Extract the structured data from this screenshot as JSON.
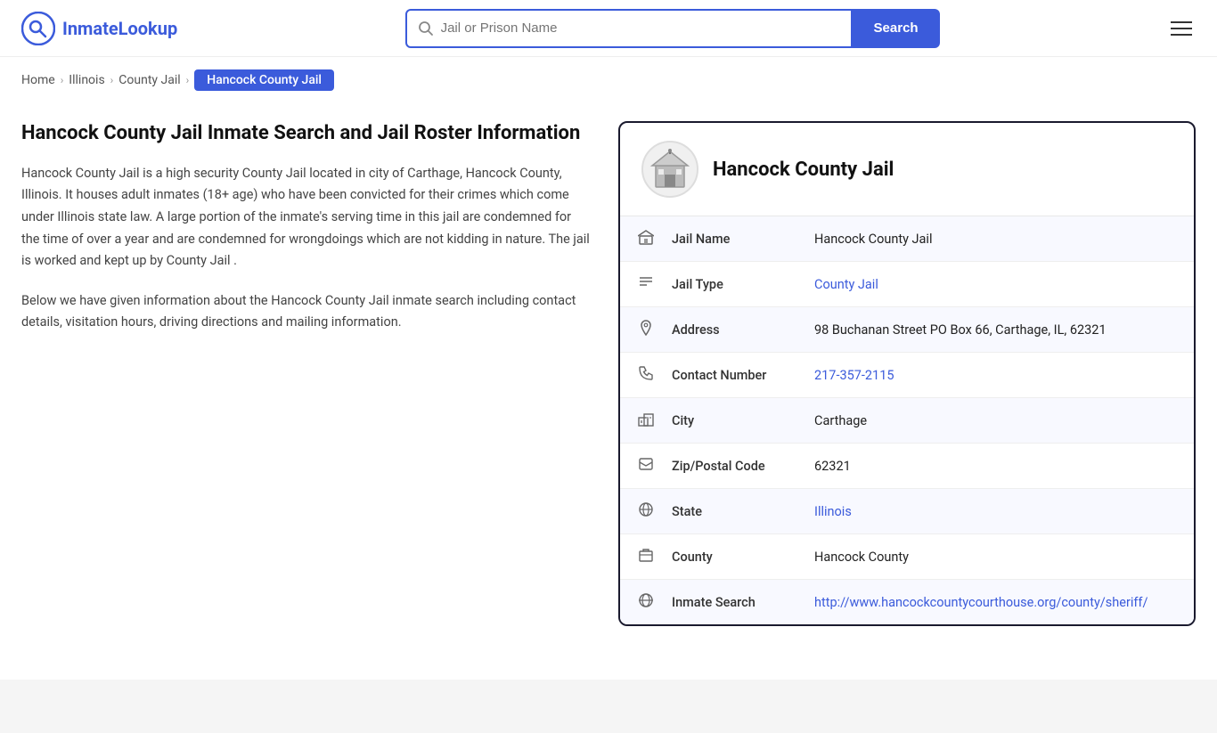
{
  "header": {
    "logo_text_part1": "Inmate",
    "logo_text_part2": "Lookup",
    "search_placeholder": "Jail or Prison Name",
    "search_button_label": "Search"
  },
  "breadcrumb": {
    "home": "Home",
    "illinois": "Illinois",
    "county_jail": "County Jail",
    "current": "Hancock County Jail"
  },
  "left": {
    "title": "Hancock County Jail Inmate Search and Jail Roster Information",
    "desc1": "Hancock County Jail is a high security County Jail located in city of Carthage, Hancock County, Illinois. It houses adult inmates (18+ age) who have been convicted for their crimes which come under Illinois state law. A large portion of the inmate's serving time in this jail are condemned for the time of over a year and are condemned for wrongdoings which are not kidding in nature. The jail is worked and kept up by County Jail .",
    "desc2": "Below we have given information about the Hancock County Jail inmate search including contact details, visitation hours, driving directions and mailing information."
  },
  "card": {
    "jail_name_display": "Hancock County Jail",
    "rows": [
      {
        "icon": "jail",
        "label": "Jail Name",
        "value": "Hancock County Jail",
        "link": null
      },
      {
        "icon": "type",
        "label": "Jail Type",
        "value": "County Jail",
        "link": "#"
      },
      {
        "icon": "address",
        "label": "Address",
        "value": "98 Buchanan Street PO Box 66, Carthage, IL, 62321",
        "link": null
      },
      {
        "icon": "phone",
        "label": "Contact Number",
        "value": "217-357-2115",
        "link": "tel:217-357-2115"
      },
      {
        "icon": "city",
        "label": "City",
        "value": "Carthage",
        "link": null
      },
      {
        "icon": "zip",
        "label": "Zip/Postal Code",
        "value": "62321",
        "link": null
      },
      {
        "icon": "state",
        "label": "State",
        "value": "Illinois",
        "link": "#"
      },
      {
        "icon": "county",
        "label": "County",
        "value": "Hancock County",
        "link": null
      },
      {
        "icon": "inmate",
        "label": "Inmate Search",
        "value": "http://www.hancockcountycourthouse.org/county/sheriff/",
        "link": "http://www.hancockcountycourthouse.org/county/sheriff/"
      }
    ]
  }
}
